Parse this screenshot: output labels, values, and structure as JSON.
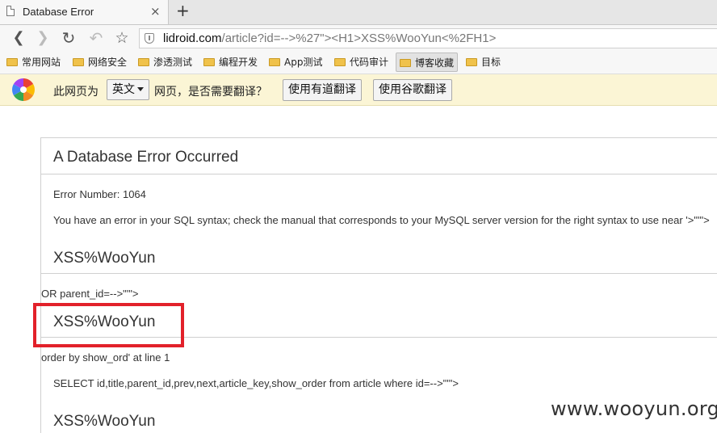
{
  "tab": {
    "title": "Database Error",
    "close": "×",
    "new_tab": "+"
  },
  "toolbar": {
    "back": "❮",
    "forward": "❯",
    "reload": "↻",
    "undo": "↶",
    "bookmark_star": "☆",
    "url_host": "lidroid.com",
    "url_path": "/article?id=-->%27\"><H1>XSS%WooYun<%2FH1>"
  },
  "bookmarks": [
    {
      "label": "常用网站"
    },
    {
      "label": "网络安全"
    },
    {
      "label": "渗透测试"
    },
    {
      "label": "编程开发"
    },
    {
      "label": "App测试"
    },
    {
      "label": "代码审计"
    },
    {
      "label": "博客收藏"
    },
    {
      "label": "目标"
    }
  ],
  "translate": {
    "prefix": "此网页为",
    "language": "英文",
    "suffix": "网页，是否需要翻译？",
    "youdao_button": "使用有道翻译",
    "google_button": "使用谷歌翻译"
  },
  "error_page": {
    "heading": "A Database Error Occurred",
    "error_number": "Error Number: 1064",
    "message": "You have an error in your SQL syntax; check the manual that corresponds to your MySQL server version for the right syntax to use near '>\"'\">",
    "xss_1": "XSS%WooYun",
    "or_parent": "OR parent_id=-->\"'\">",
    "xss_2": "XSS%WooYun",
    "order_by": "order by show_ord' at line 1",
    "select": "SELECT id,title,parent_id,prev,next,article_key,show_order from article where id=-->\"'\">",
    "xss_3": "XSS%WooYun"
  },
  "watermark": "www.wooyun.org",
  "colors": {
    "highlight_box": "#e2212a",
    "translate_bar": "#fbf5d5",
    "folder": "#f0c24b"
  },
  "icons": [
    "page-icon",
    "back-icon",
    "forward-icon",
    "reload-icon",
    "undo-icon",
    "star-icon",
    "shield-icon",
    "folder-icon",
    "translate-logo-icon",
    "dropdown-arrow-icon"
  ]
}
